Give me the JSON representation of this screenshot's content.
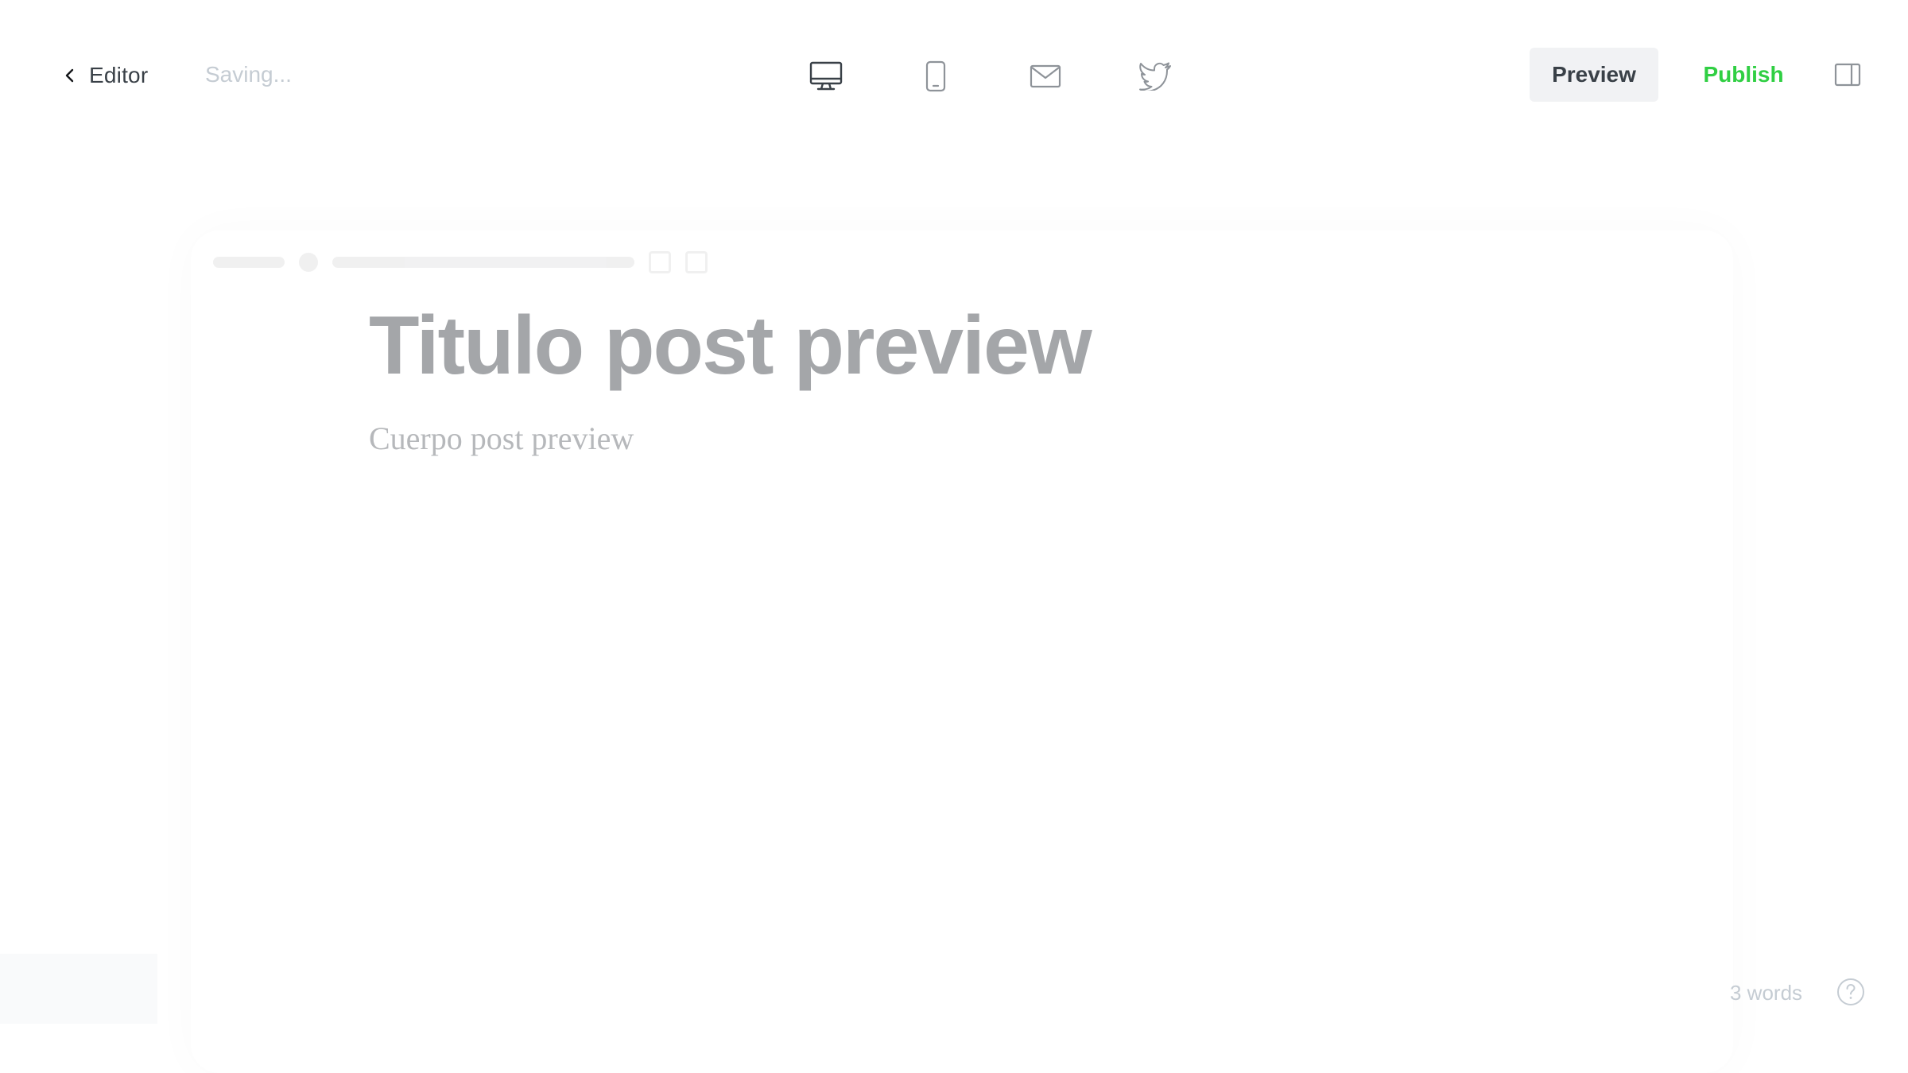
{
  "header": {
    "back_label": "Editor",
    "status": "Saving...",
    "device_toggles": [
      {
        "icon": "desktop-icon",
        "active": true
      },
      {
        "icon": "mobile-icon",
        "active": false
      },
      {
        "icon": "email-icon",
        "active": false
      },
      {
        "icon": "twitter-icon",
        "active": false
      }
    ],
    "preview_label": "Preview",
    "publish_label": "Publish",
    "sidebar_icon": "sidebar-toggle-icon"
  },
  "post": {
    "title": "Titulo post preview",
    "body": "Cuerpo post preview"
  },
  "footer": {
    "word_count": "3 words",
    "help_icon": "help-icon"
  },
  "colors": {
    "publish_accent": "#30cf43",
    "preview_bg": "#f1f2f4",
    "title_text": "#a4a6a9",
    "muted_text": "#c5ccd3"
  }
}
